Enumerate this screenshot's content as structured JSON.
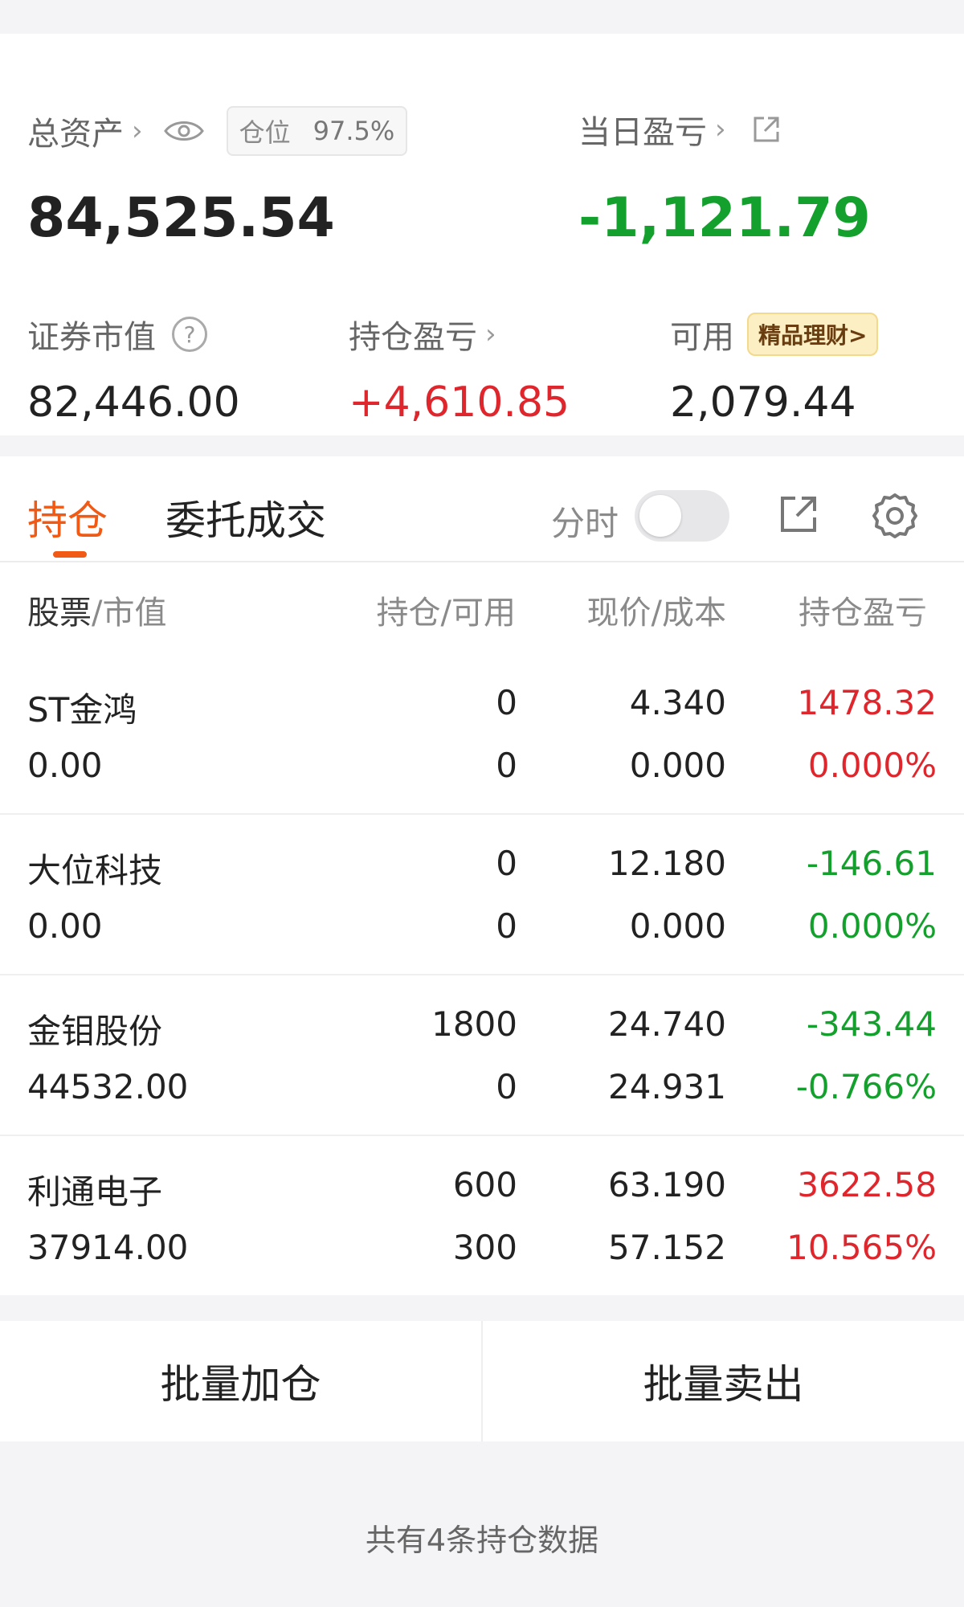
{
  "assets": {
    "total_label": "总资产",
    "total_value": "84,525.54",
    "position_label": "仓位",
    "position_value": "97.5%",
    "daily_label": "当日盈亏",
    "daily_value": "-1,121.79",
    "market_value_label": "证券市值",
    "market_value": "82,446.00",
    "holding_pnl_label": "持仓盈亏",
    "holding_pnl": "+4,610.85",
    "available_label": "可用",
    "available_value": "2,079.44",
    "promo_label": "精品理财>"
  },
  "tabs": {
    "holdings": "持仓",
    "orders": "委托成交",
    "intraday_label": "分时"
  },
  "table": {
    "header_stock": "股票",
    "header_market_value": "/市值",
    "header_hold": "持仓/可用",
    "header_price": "现价/成本",
    "header_pnl": "持仓盈亏",
    "rows": [
      {
        "name": "ST金鸿",
        "market_value": "0.00",
        "hold": "0",
        "available": "0",
        "price": "4.340",
        "cost": "0.000",
        "pnl": "1478.32",
        "pnl_pct": "0.000%",
        "pnl_color": "red",
        "pct_color": "red"
      },
      {
        "name": "大位科技",
        "market_value": "0.00",
        "hold": "0",
        "available": "0",
        "price": "12.180",
        "cost": "0.000",
        "pnl": "-146.61",
        "pnl_pct": "0.000%",
        "pnl_color": "green",
        "pct_color": "green"
      },
      {
        "name": "金钼股份",
        "market_value": "44532.00",
        "hold": "1800",
        "available": "0",
        "price": "24.740",
        "cost": "24.931",
        "pnl": "-343.44",
        "pnl_pct": "-0.766%",
        "pnl_color": "green",
        "pct_color": "green"
      },
      {
        "name": "利通电子",
        "market_value": "37914.00",
        "hold": "600",
        "available": "300",
        "price": "63.190",
        "cost": "57.152",
        "pnl": "3622.58",
        "pnl_pct": "10.565%",
        "pnl_color": "red",
        "pct_color": "red"
      }
    ]
  },
  "actions": {
    "batch_add": "批量加仓",
    "batch_sell": "批量卖出"
  },
  "footer": {
    "summary": "共有4条持仓数据"
  },
  "colors": {
    "accent": "#f05a14",
    "up_red": "#e0262d",
    "down_green": "#14a02c"
  },
  "icons": [
    "chevron-right-icon",
    "eye-icon",
    "external-link-icon",
    "question-icon",
    "gear-icon"
  ]
}
